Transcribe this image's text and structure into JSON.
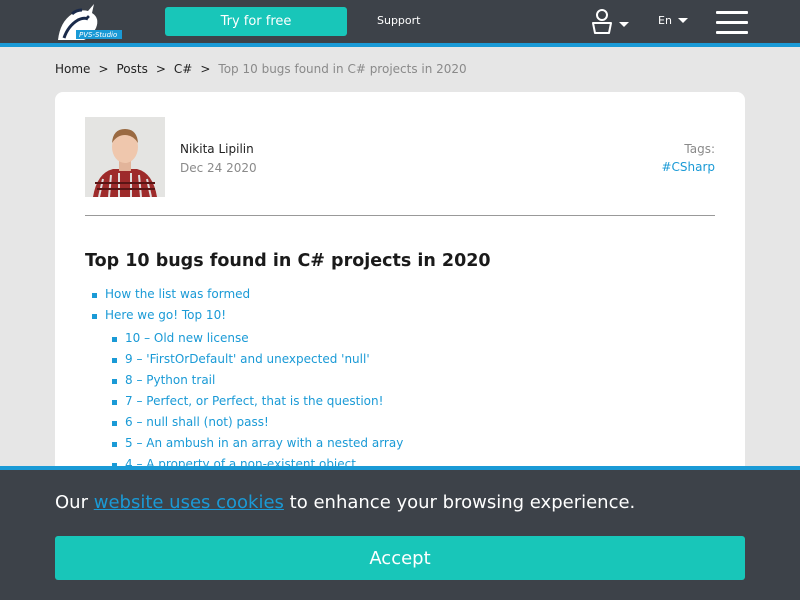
{
  "header": {
    "logo_text": "PVS-Studio",
    "try_button": "Try for free",
    "support_link": "Support",
    "language": "En"
  },
  "breadcrumb": {
    "items": [
      "Home",
      "Posts",
      "C#"
    ],
    "separator": ">",
    "current": "Top 10 bugs found in C# projects in 2020"
  },
  "post": {
    "author": "Nikita Lipilin",
    "date": "Dec 24 2020",
    "tags_label": "Tags:",
    "tag": "#CSharp",
    "title": "Top 10 bugs found in C# projects in 2020"
  },
  "toc": {
    "items": [
      "How the list was formed",
      "Here we go! Top 10!"
    ],
    "subitems": [
      "10 – Old new license",
      "9 – 'FirstOrDefault' and unexpected 'null'",
      "8 – Python trail",
      "7 – Perfect, or Perfect, that is the question!",
      "6 – null shall (not) pass!",
      "5 – An ambush in an array with a nested array",
      "4 – A property of a non-existent object"
    ]
  },
  "cookie": {
    "text_before": "Our",
    "link": "website uses cookies",
    "text_after": "to enhance your browsing experience.",
    "accept": "Accept"
  },
  "colors": {
    "header_bg": "#3d4249",
    "accent_teal": "#18c6b9",
    "link_blue": "#1a9ad6",
    "page_bg": "#e6e6e6"
  }
}
